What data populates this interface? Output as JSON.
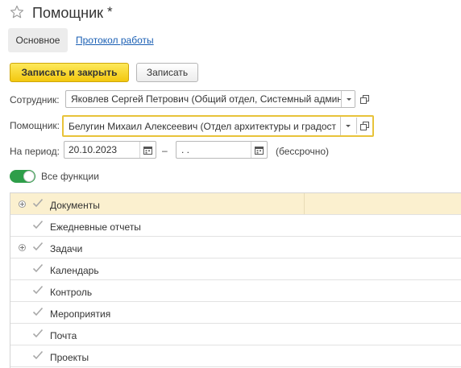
{
  "header": {
    "title": "Помощник",
    "modified_mark": "*",
    "favorite_icon": "star-icon"
  },
  "tabs": {
    "main": "Основное",
    "log": "Протокол работы"
  },
  "toolbar": {
    "save_close_label": "Записать и закрыть",
    "save_label": "Записать"
  },
  "form": {
    "employee_label": "Сотрудник:",
    "employee_value": "Яковлев Сергей Петрович (Общий отдел, Системный админ",
    "assistant_label": "Помощник:",
    "assistant_value": "Белугин Михаил Алексеевич (Отдел архитектуры и градост",
    "period_label": "На период:",
    "period_from": "20.10.2023",
    "period_dash": "–",
    "period_to": " .  .",
    "period_note": "(бессрочно)"
  },
  "toggle": {
    "label": "Все функции",
    "on": true
  },
  "tree": {
    "rows": [
      {
        "label": "Документы",
        "expandable": true,
        "selected": true,
        "checked": true
      },
      {
        "label": "Ежедневные отчеты",
        "expandable": false,
        "selected": false,
        "checked": true
      },
      {
        "label": "Задачи",
        "expandable": true,
        "selected": false,
        "checked": true
      },
      {
        "label": "Календарь",
        "expandable": false,
        "selected": false,
        "checked": true
      },
      {
        "label": "Контроль",
        "expandable": false,
        "selected": false,
        "checked": true
      },
      {
        "label": "Мероприятия",
        "expandable": false,
        "selected": false,
        "checked": true
      },
      {
        "label": "Почта",
        "expandable": false,
        "selected": false,
        "checked": true
      },
      {
        "label": "Проекты",
        "expandable": false,
        "selected": false,
        "checked": true
      }
    ]
  },
  "colors": {
    "accent_yellow": "#f3c80f",
    "focus_border": "#e8c33a",
    "link": "#1a5fb4",
    "toggle_on": "#2e9e49",
    "selected_row": "#fbf0cf"
  }
}
